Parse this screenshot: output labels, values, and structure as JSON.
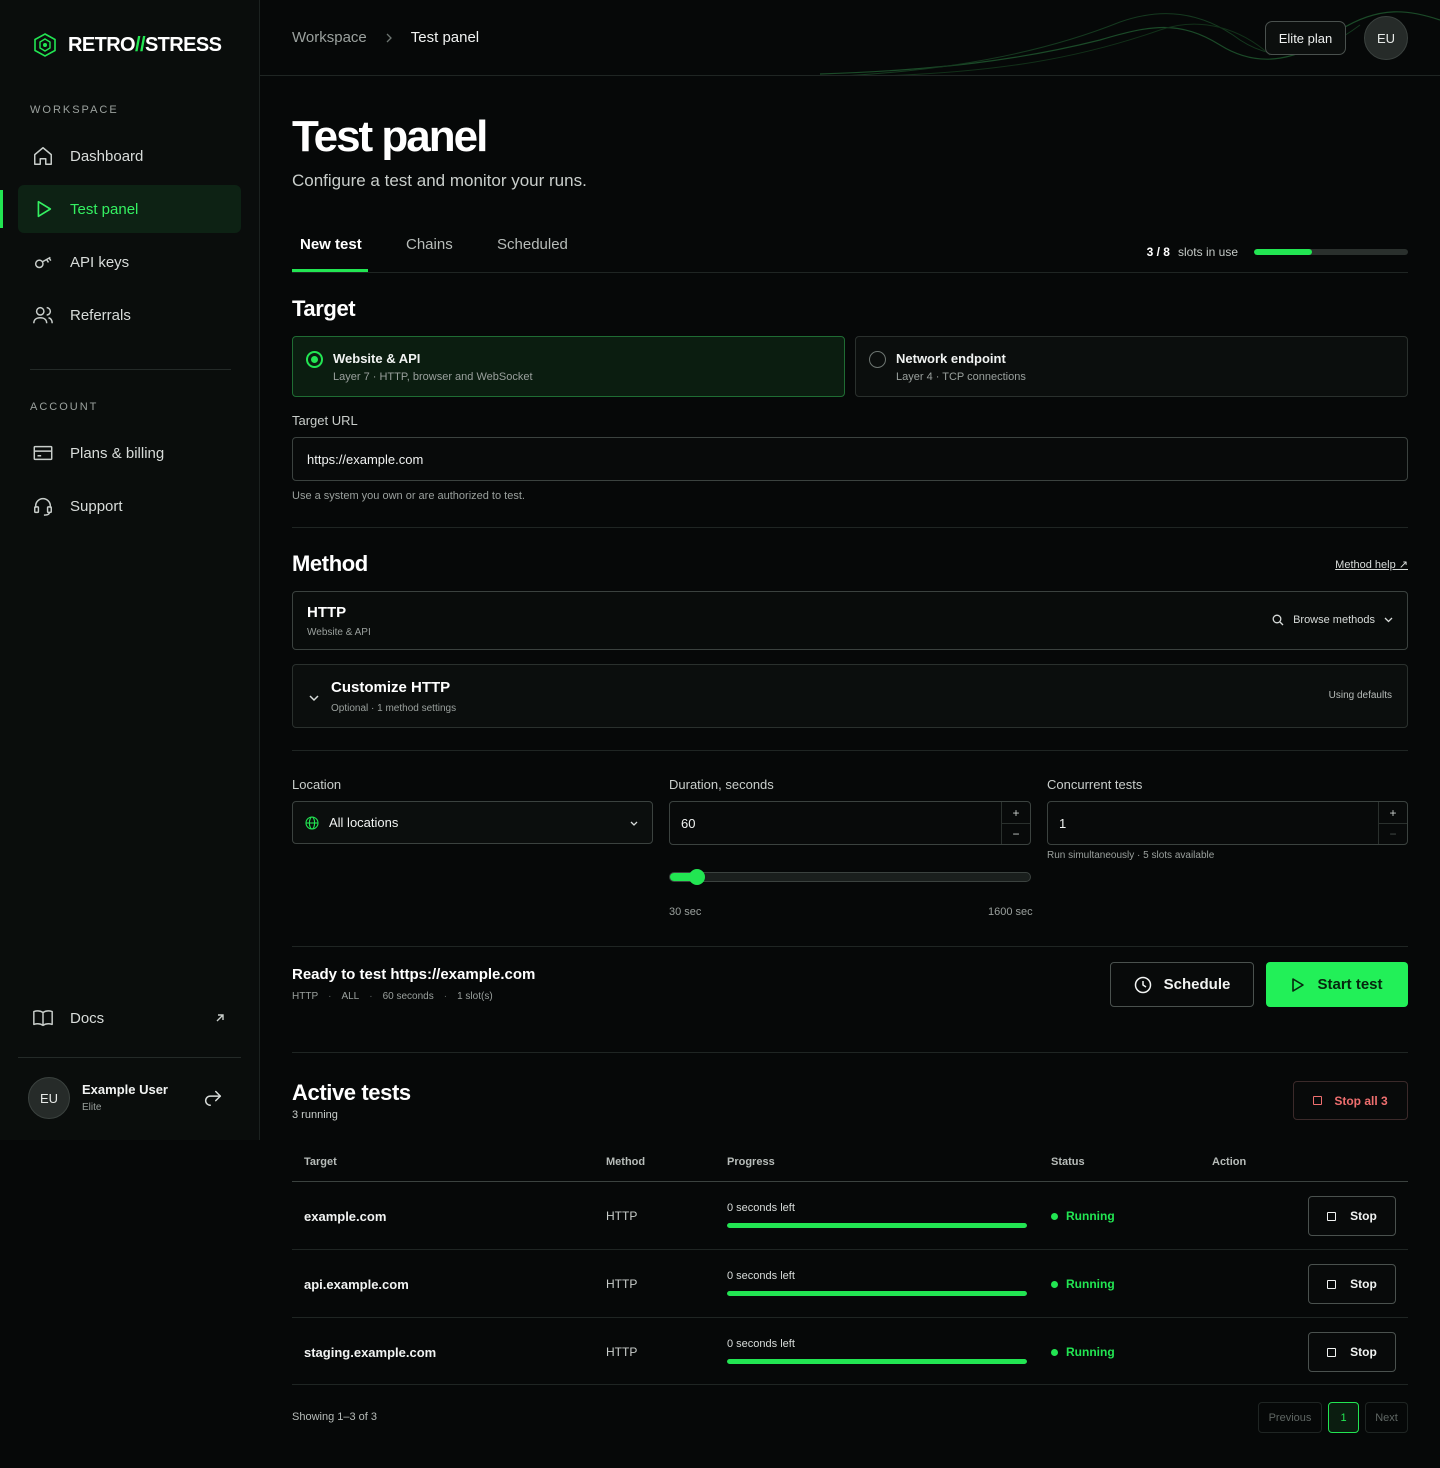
{
  "brand": {
    "name_part1": "RETRO",
    "name_slash": "//",
    "name_part2": "STRESS",
    "accent": "#22e552"
  },
  "sidebar": {
    "workspace_label": "WORKSPACE",
    "workspace_items": [
      {
        "label": "Dashboard",
        "icon": "home-icon"
      },
      {
        "label": "Test panel",
        "icon": "play-icon",
        "active": true
      },
      {
        "label": "API keys",
        "icon": "key-icon"
      },
      {
        "label": "Referrals",
        "icon": "users-icon"
      }
    ],
    "account_label": "ACCOUNT",
    "account_items": [
      {
        "label": "Plans & billing",
        "icon": "credit-card-icon"
      },
      {
        "label": "Support",
        "icon": "headset-icon"
      }
    ],
    "docs_label": "Docs",
    "user": {
      "initials": "EU",
      "name": "Example User",
      "plan": "Elite"
    }
  },
  "header": {
    "breadcrumb_root": "Workspace",
    "breadcrumb_current": "Test panel",
    "plan_button": "Elite plan",
    "avatar_initials": "EU"
  },
  "page": {
    "title": "Test panel",
    "subtitle": "Configure a test and monitor your runs."
  },
  "tabs": [
    {
      "label": "New test",
      "active": true
    },
    {
      "label": "Chains"
    },
    {
      "label": "Scheduled"
    }
  ],
  "slots": {
    "used_text": "3 / 8",
    "suffix": "slots in use",
    "used": 3,
    "total": 8
  },
  "target": {
    "heading": "Target",
    "options": [
      {
        "title": "Website & API",
        "subtitle": "Layer 7 · HTTP, browser and WebSocket",
        "selected": true
      },
      {
        "title": "Network endpoint",
        "subtitle": "Layer 4 · TCP connections",
        "selected": false
      }
    ],
    "url_label": "Target URL",
    "url_value": "https://example.com",
    "url_hint": "Use a system you own or are authorized to test."
  },
  "method": {
    "heading": "Method",
    "help_link": "Method help ↗",
    "selected_name": "HTTP",
    "selected_sub": "Website & API",
    "browse_label": "Browse methods",
    "customize_title": "Customize HTTP",
    "customize_sub": "Optional · 1 method settings",
    "customize_status": "Using defaults"
  },
  "config": {
    "location_label": "Location",
    "location_value": "All locations",
    "duration_label": "Duration, seconds",
    "duration_value": "60",
    "duration_min_label": "30 sec",
    "duration_max_label": "1600 sec",
    "duration_min": 30,
    "duration_max": 1600,
    "duration": 60,
    "concurrent_label": "Concurrent tests",
    "concurrent_value": "1",
    "concurrent_hint": "Run simultaneously · 5 slots available"
  },
  "summary": {
    "title": "Ready to test https://example.com",
    "chips": [
      "HTTP",
      "ALL",
      "60 seconds",
      "1 slot(s)"
    ],
    "schedule_button": "Schedule",
    "start_button": "Start test"
  },
  "active": {
    "heading": "Active tests",
    "count_text": "3 running",
    "stop_all_button": "Stop all 3",
    "columns": [
      "Target",
      "Method",
      "Progress",
      "Status",
      "Action"
    ],
    "rows": [
      {
        "target": "example.com",
        "method": "HTTP",
        "progress_text": "0 seconds left",
        "progress": 1.0,
        "status": "Running",
        "action": "Stop"
      },
      {
        "target": "api.example.com",
        "method": "HTTP",
        "progress_text": "0 seconds left",
        "progress": 1.0,
        "status": "Running",
        "action": "Stop"
      },
      {
        "target": "staging.example.com",
        "method": "HTTP",
        "progress_text": "0 seconds left",
        "progress": 1.0,
        "status": "Running",
        "action": "Stop"
      }
    ],
    "showing_text": "Showing 1–3 of 3",
    "pager": {
      "previous": "Previous",
      "current": "1",
      "next": "Next"
    }
  }
}
